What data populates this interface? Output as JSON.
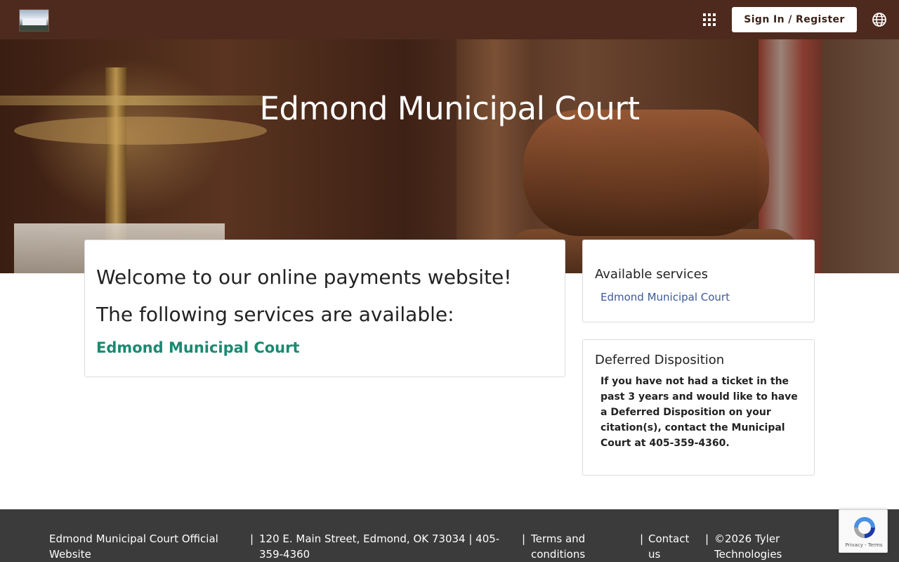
{
  "header": {
    "sign_in_label": "Sign In / Register",
    "logo_icon": "court-building-logo",
    "apps_icon": "apps-grid-icon",
    "language_icon": "globe-icon"
  },
  "hero": {
    "title": "Edmond Municipal Court"
  },
  "welcome": {
    "title": "Welcome to our online payments website!",
    "subtitle": "The following services are available:",
    "service_link": "Edmond Municipal Court"
  },
  "available_services": {
    "title": "Available services",
    "items": [
      "Edmond Municipal Court"
    ]
  },
  "deferred": {
    "title": "Deferred Disposition",
    "body": "If you have not had a ticket in the past 3 years and would like to have a Deferred Disposition on your citation(s), contact the Municipal Court at 405-359-4360."
  },
  "footer": {
    "site_name": "Edmond Municipal Court Official Website",
    "address": "120 E. Main Street, Edmond, OK 73034 | 405-359-4360",
    "terms": "Terms and conditions",
    "contact": "Contact us",
    "copyright": "©2026 Tyler Technologies",
    "separator": "|"
  },
  "recaptcha": {
    "text": "Privacy - Terms",
    "icon": "recaptcha-icon"
  },
  "colors": {
    "header_bg": "#4e2a1e",
    "link_green": "#1a8a72",
    "link_blue": "#3c5a9a",
    "footer_bg": "#3b3b3b"
  }
}
